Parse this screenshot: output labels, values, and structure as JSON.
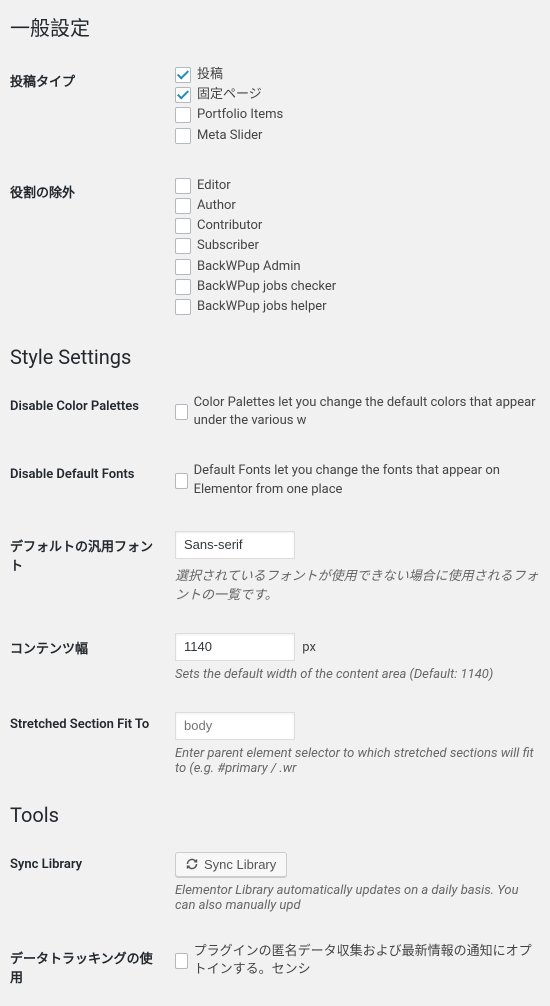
{
  "sections": {
    "general": {
      "title": "一般設定"
    },
    "style": {
      "title": "Style Settings"
    },
    "tools": {
      "title": "Tools"
    }
  },
  "post_types": {
    "label": "投稿タイプ",
    "items": [
      {
        "label": "投稿",
        "checked": true
      },
      {
        "label": "固定ページ",
        "checked": true
      },
      {
        "label": "Portfolio Items",
        "checked": false
      },
      {
        "label": "Meta Slider",
        "checked": false
      }
    ]
  },
  "exclude_roles": {
    "label": "役割の除外",
    "items": [
      {
        "label": "Editor",
        "checked": false
      },
      {
        "label": "Author",
        "checked": false
      },
      {
        "label": "Contributor",
        "checked": false
      },
      {
        "label": "Subscriber",
        "checked": false
      },
      {
        "label": "BackWPup Admin",
        "checked": false
      },
      {
        "label": "BackWPup jobs checker",
        "checked": false
      },
      {
        "label": "BackWPup jobs helper",
        "checked": false
      }
    ]
  },
  "disable_palettes": {
    "label": "Disable Color Palettes",
    "desc": "Color Palettes let you change the default colors that appear under the various w",
    "checked": false
  },
  "disable_fonts": {
    "label": "Disable Default Fonts",
    "desc": "Default Fonts let you change the fonts that appear on Elementor from one place",
    "checked": false
  },
  "generic_font": {
    "label": "デフォルトの汎用フォント",
    "value": "Sans-serif",
    "desc": "選択されているフォントが使用できない場合に使用されるフォントの一覧です。"
  },
  "content_width": {
    "label": "コンテンツ幅",
    "value": "1140",
    "unit": "px",
    "desc": "Sets the default width of the content area (Default: 1140)"
  },
  "stretched_fit": {
    "label": "Stretched Section Fit To",
    "value": "",
    "placeholder": "body",
    "desc": "Enter parent element selector to which stretched sections will fit to (e.g. #primary / .wr"
  },
  "sync_library": {
    "label": "Sync Library",
    "button": "Sync Library",
    "desc": "Elementor Library automatically updates on a daily basis. You can also manually upd"
  },
  "data_tracking": {
    "label": "データトラッキングの使用",
    "desc": "プラグインの匿名データ収集および最新情報の通知にオプトインする。センシ",
    "checked": false
  }
}
